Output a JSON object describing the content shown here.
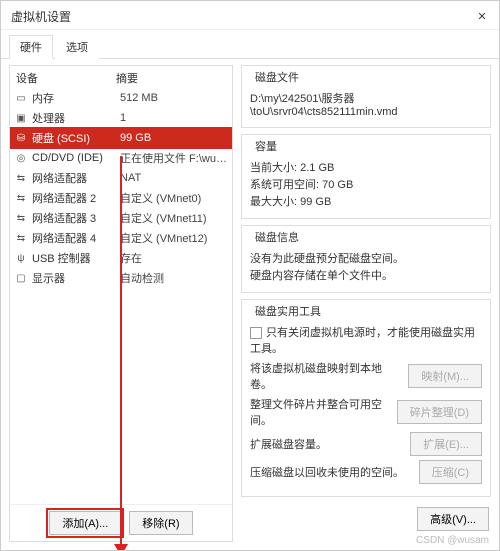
{
  "window": {
    "title": "虚拟机设置"
  },
  "tabs": {
    "hardware": "硬件",
    "options": "选项"
  },
  "hw_header": {
    "device": "设备",
    "summary": "摘要"
  },
  "hw": [
    {
      "icon": "memory-icon",
      "glyph": "▭",
      "label": "内存",
      "summary": "512 MB"
    },
    {
      "icon": "cpu-icon",
      "glyph": "▣",
      "label": "处理器",
      "summary": "1"
    },
    {
      "icon": "disk-icon",
      "glyph": "⛁",
      "label": "硬盘 (SCSI)",
      "summary": "99 GB"
    },
    {
      "icon": "cd-icon",
      "glyph": "◎",
      "label": "CD/DVD (IDE)",
      "summary": "正在使用文件 F:\\wutool\\Cent..."
    },
    {
      "icon": "nic-icon",
      "glyph": "⇆",
      "label": "网络适配器",
      "summary": "NAT"
    },
    {
      "icon": "nic-icon",
      "glyph": "⇆",
      "label": "网络适配器 2",
      "summary": "自定义 (VMnet0)"
    },
    {
      "icon": "nic-icon",
      "glyph": "⇆",
      "label": "网络适配器 3",
      "summary": "自定义 (VMnet11)"
    },
    {
      "icon": "nic-icon",
      "glyph": "⇆",
      "label": "网络适配器 4",
      "summary": "自定义 (VMnet12)"
    },
    {
      "icon": "usb-icon",
      "glyph": "ψ",
      "label": "USB 控制器",
      "summary": "存在"
    },
    {
      "icon": "display-icon",
      "glyph": "▢",
      "label": "显示器",
      "summary": "自动检测"
    }
  ],
  "selected_index": 2,
  "buttons": {
    "add": "添加(A)...",
    "remove": "移除(R)",
    "advanced": "高级(V)...",
    "map": "映射(M)...",
    "defrag": "碎片整理(D)",
    "expand": "扩展(E)...",
    "compact": "压缩(C)"
  },
  "disk_file": {
    "label": "磁盘文件",
    "path": "D:\\my\\242501\\服务器\\toU\\srvr04\\cts852111min.vmd"
  },
  "capacity": {
    "title": "容量",
    "current_label": "当前大小:",
    "current_value": "2.1 GB",
    "sysfree_label": "系统可用空间:",
    "sysfree_value": "70 GB",
    "max_label": "最大大小:",
    "max_value": "99 GB"
  },
  "disk_info": {
    "title": "磁盘信息",
    "line1": "没有为此硬盘预分配磁盘空间。",
    "line2": "硬盘内容存储在单个文件中。"
  },
  "utilities": {
    "title": "磁盘实用工具",
    "poweroff_note": "只有关闭虚拟机电源时，才能使用磁盘实用工具。",
    "map_text": "将该虚拟机磁盘映射到本地卷。",
    "defrag_text": "整理文件碎片并整合可用空间。",
    "expand_text": "扩展磁盘容量。",
    "compact_text": "压缩磁盘以回收未使用的空间。"
  },
  "watermark": "CSDN @wusam"
}
